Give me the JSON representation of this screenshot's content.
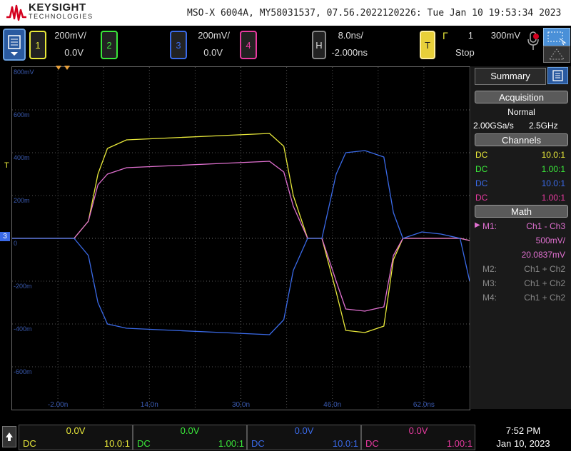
{
  "header": {
    "brand": "KEYSIGHT",
    "brand_sub": "TECHNOLOGIES",
    "model_info": "MSO-X 6004A, MY58031537, 07.56.2022120226: Tue Jan 10 19:53:34 2023"
  },
  "channels": [
    {
      "num": "1",
      "scale": "200mV/",
      "offset": "0.0V",
      "color": "#e8e83a"
    },
    {
      "num": "2",
      "scale": "",
      "offset": "",
      "color": "#3ae83a"
    },
    {
      "num": "3",
      "scale": "200mV/",
      "offset": "0.0V",
      "color": "#3a6ae8"
    },
    {
      "num": "4",
      "scale": "",
      "offset": "",
      "color": "#e83aa0"
    }
  ],
  "horizontal": {
    "label": "H",
    "scale": "8.0ns/",
    "offset": "-2.000ns"
  },
  "trigger": {
    "label": "T",
    "symbol": "Γ",
    "source": "1",
    "level": "300mV",
    "status": "Stop"
  },
  "grid": {
    "y_labels": [
      "800mV",
      "600m",
      "400m",
      "200m",
      "0",
      "-200m",
      "-400m",
      "-600m"
    ],
    "x_labels": [
      "-2.00n",
      "14.0n",
      "30.0n",
      "46.0n",
      "62.0ns"
    ],
    "marker_t": "T",
    "marker_ref": "3"
  },
  "chart_data": {
    "type": "line",
    "xlabel": "",
    "ylabel": "",
    "xlim": [
      -34,
      62
    ],
    "ylim": [
      -800,
      800
    ],
    "x_units": "ns",
    "y_units": "mV",
    "series": [
      {
        "name": "",
        "color": "#e8e83a",
        "x": [
          -34,
          -21,
          -18,
          -16,
          -14,
          -10,
          0,
          10,
          20,
          23,
          25,
          28,
          31,
          34,
          36,
          40,
          44,
          46,
          48,
          52,
          56,
          60,
          62
        ],
        "y": [
          0,
          0,
          80,
          300,
          420,
          460,
          470,
          480,
          490,
          430,
          200,
          0,
          0,
          -250,
          -430,
          -440,
          -410,
          -100,
          0,
          0,
          0,
          0,
          -10
        ]
      },
      {
        "name": "",
        "color": "#e070d0",
        "x": [
          -34,
          -21,
          -18,
          -16,
          -14,
          -10,
          0,
          10,
          20,
          23,
          25,
          28,
          31,
          34,
          36,
          40,
          44,
          46,
          48,
          52,
          56,
          60,
          62
        ],
        "y": [
          0,
          0,
          80,
          250,
          300,
          330,
          340,
          350,
          360,
          310,
          150,
          0,
          0,
          -200,
          -330,
          -340,
          -320,
          -80,
          0,
          0,
          0,
          0,
          -10
        ]
      },
      {
        "name": "",
        "color": "#3a6ae8",
        "x": [
          -34,
          -21,
          -18,
          -16,
          -14,
          -10,
          0,
          10,
          20,
          23,
          25,
          28,
          31,
          34,
          36,
          40,
          44,
          46,
          48,
          52,
          56,
          60,
          62
        ],
        "y": [
          0,
          0,
          -80,
          -300,
          -400,
          -420,
          -430,
          -440,
          -450,
          -380,
          -150,
          0,
          0,
          300,
          400,
          410,
          380,
          120,
          0,
          30,
          20,
          0,
          -200
        ]
      }
    ]
  },
  "summary": {
    "title": "Summary",
    "acq_head": "Acquisition",
    "acq_mode": "Normal",
    "acq_rate": "2.00GSa/s",
    "acq_bw": "2.5GHz",
    "ch_head": "Channels",
    "channels": [
      {
        "coupling": "DC",
        "probe": "10.0:1",
        "color": "#e8e83a"
      },
      {
        "coupling": "DC",
        "probe": "1.00:1",
        "color": "#3ae83a"
      },
      {
        "coupling": "DC",
        "probe": "10.0:1",
        "color": "#3a6ae8"
      },
      {
        "coupling": "DC",
        "probe": "1.00:1",
        "color": "#e83aa0"
      }
    ],
    "math_head": "Math",
    "math": [
      {
        "label": "M1:",
        "expr": "Ch1 - Ch3",
        "active": true
      },
      {
        "label": "M2:",
        "expr": "Ch1 + Ch2",
        "active": false
      },
      {
        "label": "M3:",
        "expr": "Ch1 + Ch2",
        "active": false
      },
      {
        "label": "M4:",
        "expr": "Ch1 + Ch2",
        "active": false
      }
    ],
    "m1_scale": "500mV/",
    "m1_offset": "20.0837mV"
  },
  "bottom": {
    "cells": [
      {
        "value": "0.0V",
        "coupling": "DC",
        "probe": "10.0:1",
        "color": "#e8e83a"
      },
      {
        "value": "0.0V",
        "coupling": "DC",
        "probe": "1.00:1",
        "color": "#3ae83a"
      },
      {
        "value": "0.0V",
        "coupling": "DC",
        "probe": "10.0:1",
        "color": "#3a6ae8"
      },
      {
        "value": "0.0V",
        "coupling": "DC",
        "probe": "1.00:1",
        "color": "#e83aa0"
      }
    ],
    "time": "7:52 PM",
    "date": "Jan 10, 2023"
  }
}
